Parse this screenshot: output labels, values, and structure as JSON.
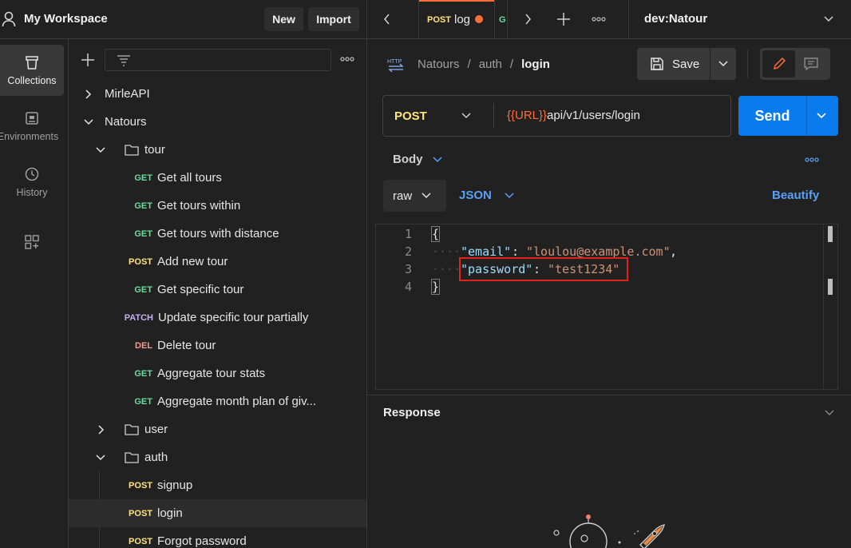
{
  "workspace": {
    "title": "My Workspace",
    "new_label": "New",
    "import_label": "Import"
  },
  "rail": {
    "items": [
      {
        "label": "Collections",
        "icon": "trash-can-collections-icon"
      },
      {
        "label": "Environments",
        "icon": "environments-icon"
      },
      {
        "label": "History",
        "icon": "history-icon"
      },
      {
        "label": "",
        "icon": "add-widgets-icon"
      }
    ]
  },
  "tree": {
    "rows": [
      {
        "label": "MirleAPI",
        "method": ""
      },
      {
        "label": "Natours",
        "method": ""
      },
      {
        "label": "tour",
        "method": ""
      },
      {
        "label": "Get all tours",
        "method": "GET"
      },
      {
        "label": "Get tours within",
        "method": "GET"
      },
      {
        "label": "Get tours with distance",
        "method": "GET"
      },
      {
        "label": "Add new tour",
        "method": "POST"
      },
      {
        "label": "Get specific tour",
        "method": "GET"
      },
      {
        "label": "Update specific tour partially",
        "method": "PATCH"
      },
      {
        "label": "Delete tour",
        "method": "DEL"
      },
      {
        "label": "Aggregate tour stats",
        "method": "GET"
      },
      {
        "label": "Aggregate month plan of giv...",
        "method": "GET"
      },
      {
        "label": "user",
        "method": ""
      },
      {
        "label": "auth",
        "method": ""
      },
      {
        "label": "signup",
        "method": "POST"
      },
      {
        "label": "login",
        "method": "POST"
      },
      {
        "label": "Forgot password",
        "method": "POST"
      }
    ]
  },
  "tabs": {
    "active_method": "POST",
    "active_label": "log",
    "next_method_letter": "G",
    "environment": "dev:Natour"
  },
  "request": {
    "breadcrumb": [
      "Natours",
      "auth",
      "login"
    ],
    "separator": "/",
    "save_label": "Save",
    "method": "POST",
    "url_var": "{{URL}}",
    "url_path": "api/v1/users/login",
    "send_label": "Send",
    "body_tab": "Body",
    "body_mode": "raw",
    "body_lang": "JSON",
    "beautify_label": "Beautify"
  },
  "editor": {
    "line_numbers": [
      "1",
      "2",
      "3",
      "4"
    ],
    "open_brace": "{",
    "close_brace": "}",
    "email_key": "\"email\"",
    "email_value": "\"loulou@example.com\"",
    "password_key": "\"password\"",
    "password_value": "\"test1234\"",
    "highlight_color": "#e0241b"
  },
  "response": {
    "title": "Response"
  },
  "colors": {
    "accent_blue": "#097bed",
    "accent_orange": "#ff6c37"
  }
}
